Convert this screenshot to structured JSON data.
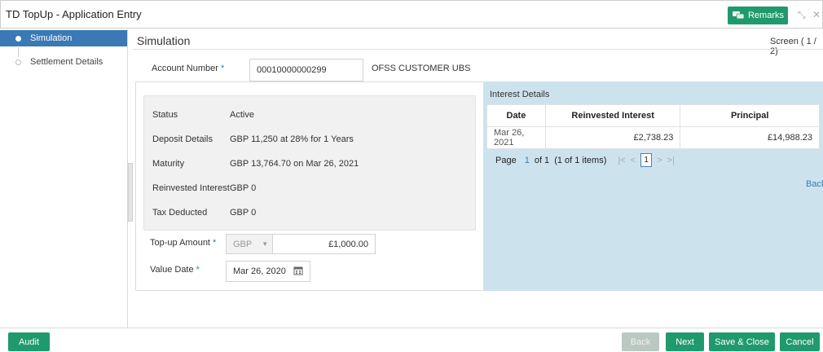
{
  "window": {
    "title": "TD TopUp - Application Entry"
  },
  "toolbar": {
    "remarks_label": "Remarks",
    "icons": [
      "remarks-icon",
      "restore-icon",
      "close-icon"
    ]
  },
  "sidebar": {
    "items": [
      {
        "label": "Simulation",
        "state": "active"
      },
      {
        "label": "Settlement Details",
        "state": "inactive"
      }
    ]
  },
  "main": {
    "title": "Simulation",
    "screen_indicator": "Screen ( 1 / 2)",
    "account_number_label": "Account Number",
    "account_number_value": "00010000000299",
    "customer_name": "OFSS CUSTOMER UBS",
    "summary": [
      {
        "label": "Status",
        "value": "Active"
      },
      {
        "label": "Deposit Details",
        "value": "GBP 11,250 at 28% for 1 Years"
      },
      {
        "label": "Maturity",
        "value": "GBP 13,764.70 on Mar 26, 2021"
      },
      {
        "label": "Reinvested Interest",
        "value": "GBP 0"
      },
      {
        "label": "Tax Deducted",
        "value": "GBP 0"
      }
    ],
    "topup_label": "Top-up Amount",
    "topup_currency": "GBP",
    "topup_amount": "£1,000.00",
    "value_date_label": "Value Date",
    "value_date": "Mar 26, 2020"
  },
  "interest_details": {
    "title": "Interest Details",
    "columns": [
      "Date",
      "Reinvested Interest",
      "Principal"
    ],
    "rows": [
      [
        "Mar 26, 2021",
        "£2,738.23",
        "£14,988.23"
      ]
    ],
    "pager": {
      "page_label": "Page",
      "page_number": "1",
      "of_text": "of 1",
      "items_text": "(1 of 1 items)",
      "current": "1"
    },
    "back_link": "Back"
  },
  "footer": {
    "audit_label": "Audit",
    "back_label": "Back",
    "next_label": "Next",
    "save_close_label": "Save & Close",
    "cancel_label": "Cancel"
  },
  "colors": {
    "accent": "#1f9a6c",
    "primary": "#3a79b4",
    "panel_bg": "#cce3ee"
  }
}
